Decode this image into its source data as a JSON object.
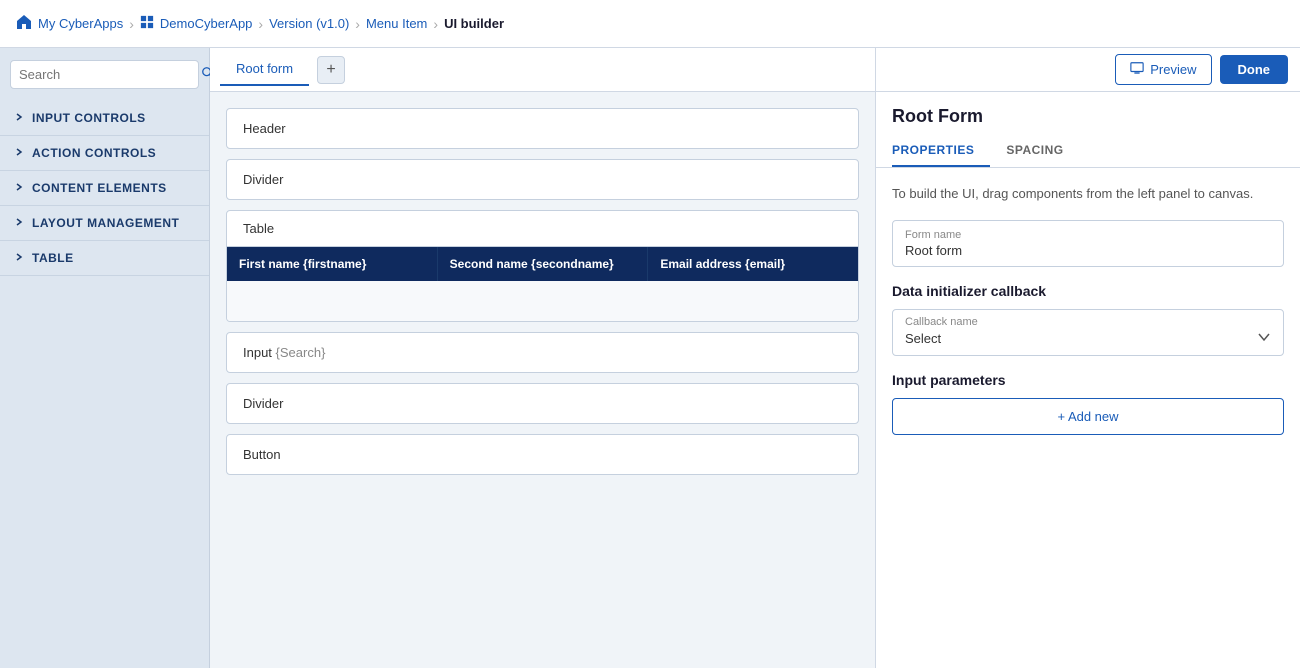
{
  "topbar": {
    "home_label": "My CyberApps",
    "app_label": "DemoCyberApp",
    "version_label": "Version (v1.0)",
    "menu_label": "Menu Item",
    "current_label": "UI builder",
    "sep": "›"
  },
  "sidebar": {
    "search_placeholder": "Search",
    "sections": [
      {
        "id": "input-controls",
        "label": "INPUT CONTROLS"
      },
      {
        "id": "action-controls",
        "label": "ACTION CONTROLS"
      },
      {
        "id": "content-elements",
        "label": "CONTENT ELEMENTS"
      },
      {
        "id": "layout-management",
        "label": "LAYOUT MANAGEMENT"
      },
      {
        "id": "table",
        "label": "TABLE"
      }
    ]
  },
  "canvas": {
    "tab_label": "Root form",
    "add_tab_icon": "+",
    "components": [
      {
        "id": "header",
        "type": "plain",
        "label": "Header"
      },
      {
        "id": "divider1",
        "type": "plain",
        "label": "Divider"
      },
      {
        "id": "table",
        "type": "table",
        "label": "Table",
        "columns": [
          "First name {firstname}",
          "Second name {secondname}",
          "Email address {email}"
        ]
      },
      {
        "id": "input",
        "type": "input",
        "label": "Input",
        "placeholder": "{Search}"
      },
      {
        "id": "divider2",
        "type": "plain",
        "label": "Divider"
      },
      {
        "id": "button",
        "type": "plain",
        "label": "Button"
      }
    ]
  },
  "right_panel": {
    "title": "Root Form",
    "preview_label": "Preview",
    "done_label": "Done",
    "tabs": [
      {
        "id": "properties",
        "label": "PROPERTIES"
      },
      {
        "id": "spacing",
        "label": "SPACING"
      }
    ],
    "hint": "To build the UI, drag components from the left panel to canvas.",
    "form_name_label": "Form name",
    "form_name_value": "Root form",
    "data_initializer_label": "Data initializer callback",
    "callback_name_label": "Callback name",
    "callback_select_value": "Select",
    "input_params_label": "Input parameters",
    "add_new_label": "+ Add new"
  }
}
